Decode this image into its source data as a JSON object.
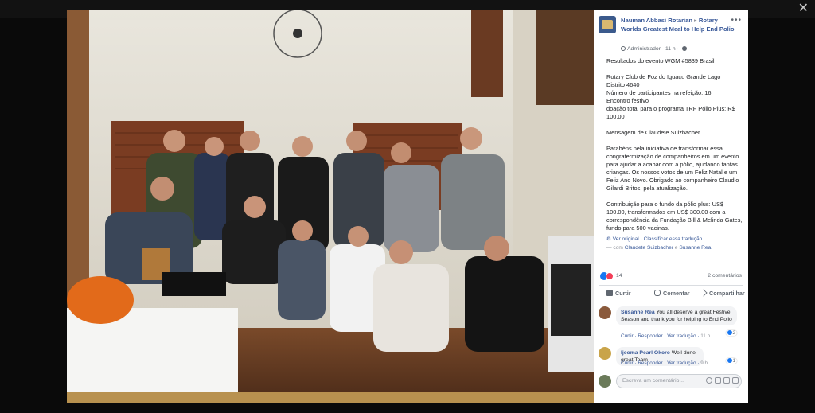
{
  "viewer": {
    "close_label": "✕"
  },
  "header": {
    "author": "Nauman Abbasi Rotarian",
    "separator": "▸",
    "group": "Rotary Worlds Greatest Meal to Help End Polio",
    "role": "Administrador",
    "time": "11 h",
    "more": "•••"
  },
  "post": {
    "lines_1": [
      "Resultados do evento WGM #5839 Brasil"
    ],
    "lines_2": [
      "Rotary Club de Foz do Iguaçu Grande Lago",
      "Distrito 4640",
      "Número de participantes na refeição: 16",
      "Encontro festivo",
      "doação total para o programa TRF Pólio Plus: R$ 100.00"
    ],
    "lines_3": [
      "Mensagem de Claudete Suizbacher"
    ],
    "lines_4": [
      "Parabéns pela iniciativa de transformar essa congratermização de companheiros em um evento para ajudar a acabar com a pólio, ajudando tantas crianças. Os nossos votos de um Feliz Natal e um Feliz Ano Novo. Obrigado ao companheiro Claudio Gilardi Britos, pela atualização."
    ],
    "lines_5": [
      "Contribuição para o fundo da pólio plus: US$ 100.00, transformados em US$ 300.00 com a correspondência da Fundação Bill & Melinda Gates, fundo para 500 vacinas."
    ],
    "see_original": "Ver original",
    "rate_translation": "Classificar essa tradução",
    "with_prefix": "— com",
    "tagged_1": "Claudete Suizbacher",
    "and": "e",
    "tagged_2": "Susanne Rea."
  },
  "reactions": {
    "count": "14",
    "comments": "2 comentários"
  },
  "actions": {
    "like": "Curtir",
    "comment": "Comentar",
    "share": "Compartilhar"
  },
  "comments": [
    {
      "name": "Susanne Rea",
      "text": "You all deserve a great Festive Season and thank you for helping to End Polio",
      "like": "Curtir",
      "reply": "Responder",
      "translate": "Ver tradução",
      "time": "11 h",
      "reactions": "2",
      "avatar_color": "#8a5a3c"
    },
    {
      "name": "Ijeoma Pearl Okoro",
      "text": "Well done great Team",
      "like": "Curtir",
      "reply": "Responder",
      "translate": "Ver tradução",
      "time": "9 h",
      "reactions": "1",
      "avatar_color": "#c9a44a"
    }
  ],
  "composer": {
    "placeholder": "Escreva um comentário..."
  },
  "colors": {
    "link": "#385898",
    "panel_bg": "#ffffff",
    "like_blue": "#1877f2"
  }
}
